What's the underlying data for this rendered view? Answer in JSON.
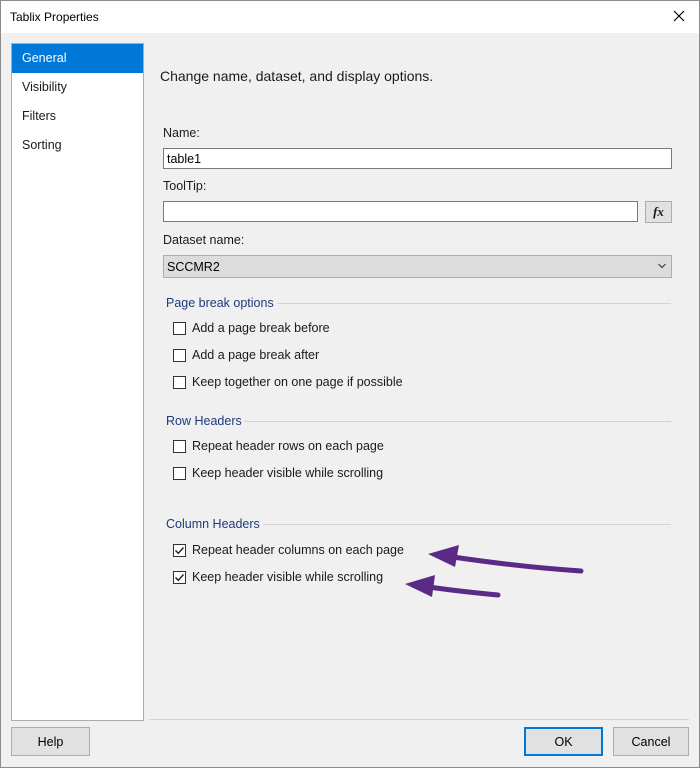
{
  "window": {
    "title": "Tablix Properties"
  },
  "sidebar": {
    "items": [
      {
        "label": "General",
        "selected": true
      },
      {
        "label": "Visibility",
        "selected": false
      },
      {
        "label": "Filters",
        "selected": false
      },
      {
        "label": "Sorting",
        "selected": false
      }
    ]
  },
  "main": {
    "heading": "Change name, dataset, and display options.",
    "name_label": "Name:",
    "name_value": "table1",
    "tooltip_label": "ToolTip:",
    "tooltip_value": "",
    "fx_label": "fx",
    "dataset_label": "Dataset name:",
    "dataset_value": "SCCMR2"
  },
  "page_break": {
    "title": "Page break options",
    "options": [
      {
        "label": "Add a page break before",
        "checked": false
      },
      {
        "label": "Add a page break after",
        "checked": false
      },
      {
        "label": "Keep together on one page if possible",
        "checked": false
      }
    ]
  },
  "row_headers": {
    "title": "Row Headers",
    "options": [
      {
        "label": "Repeat header rows on each page",
        "checked": false
      },
      {
        "label": "Keep header visible while scrolling",
        "checked": false
      }
    ]
  },
  "column_headers": {
    "title": "Column Headers",
    "options": [
      {
        "label": "Repeat header columns on each page",
        "checked": true
      },
      {
        "label": "Keep header visible while scrolling",
        "checked": true
      }
    ]
  },
  "buttons": {
    "help": "Help",
    "ok": "OK",
    "cancel": "Cancel"
  },
  "colors": {
    "selection": "#0078d7",
    "group_title": "#1f3a7a",
    "annotation_arrow": "#5b2a86"
  },
  "icons": {
    "close": "close-icon",
    "dropdown": "chevron-down-icon",
    "check": "checkmark-icon"
  }
}
